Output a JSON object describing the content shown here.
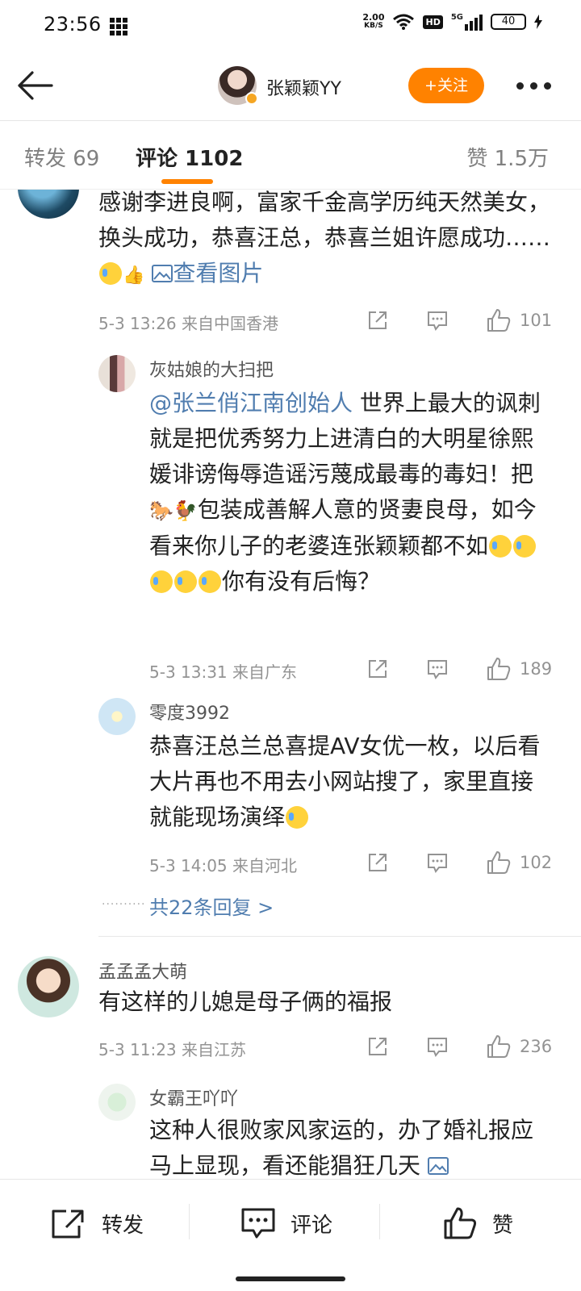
{
  "status_bar": {
    "time": "23:56",
    "net_speed_value": "2.00",
    "net_speed_unit": "KB/S",
    "hd": "HD",
    "network": "5G",
    "battery": "40"
  },
  "header": {
    "user_name": "张颖颖YY",
    "follow_label": "+关注"
  },
  "tabs": {
    "forward": "转发 69",
    "comment": "评论 1102",
    "like": "赞 1.5万"
  },
  "comments": [
    {
      "text_part1": "感谢李进良啊，富家千金高学历纯天然美女，换头成功，恭喜汪总，恭喜兰姐许愿成功……",
      "image_link": "查看图片",
      "meta": "5-3 13:26 来自中国香港",
      "likes": "101",
      "replies": [
        {
          "user": "灰姑娘的大扫把",
          "mention": "@张兰俏江南创始人",
          "text": " 世界上最大的讽刺就是把优秀努力上进清白的大明星徐熙媛诽谤侮辱造谣污蔑成最毒的毒妇！把",
          "text_b": "包装成善解人意的贤妻良母，如今看来你儿子的老婆连张颖颖都不如",
          "text_c": "你有没有后悔？",
          "meta": "5-3 13:31 来自广东",
          "likes": "189"
        },
        {
          "user": "零度3992",
          "text": "恭喜汪总兰总喜提AV女优一枚，以后看大片再也不用去小网站搜了，家里直接就能现场演绎",
          "meta": "5-3 14:05 来自河北",
          "likes": "102"
        }
      ],
      "more_replies": "共22条回复 >"
    },
    {
      "user": "孟孟孟大萌",
      "text": "有这样的儿媳是母子俩的福报",
      "meta": "5-3 11:23 来自江苏",
      "likes": "236",
      "replies": [
        {
          "user": "女霸王吖吖",
          "text": "这种人很败家风家运的，办了婚礼报应马上显现，看还能猖狂几天"
        }
      ]
    }
  ],
  "bottom_bar": {
    "forward": "转发",
    "comment": "评论",
    "like": "赞"
  },
  "colors": {
    "accent": "#ff8200",
    "link": "#507daf",
    "meta": "#939393"
  }
}
